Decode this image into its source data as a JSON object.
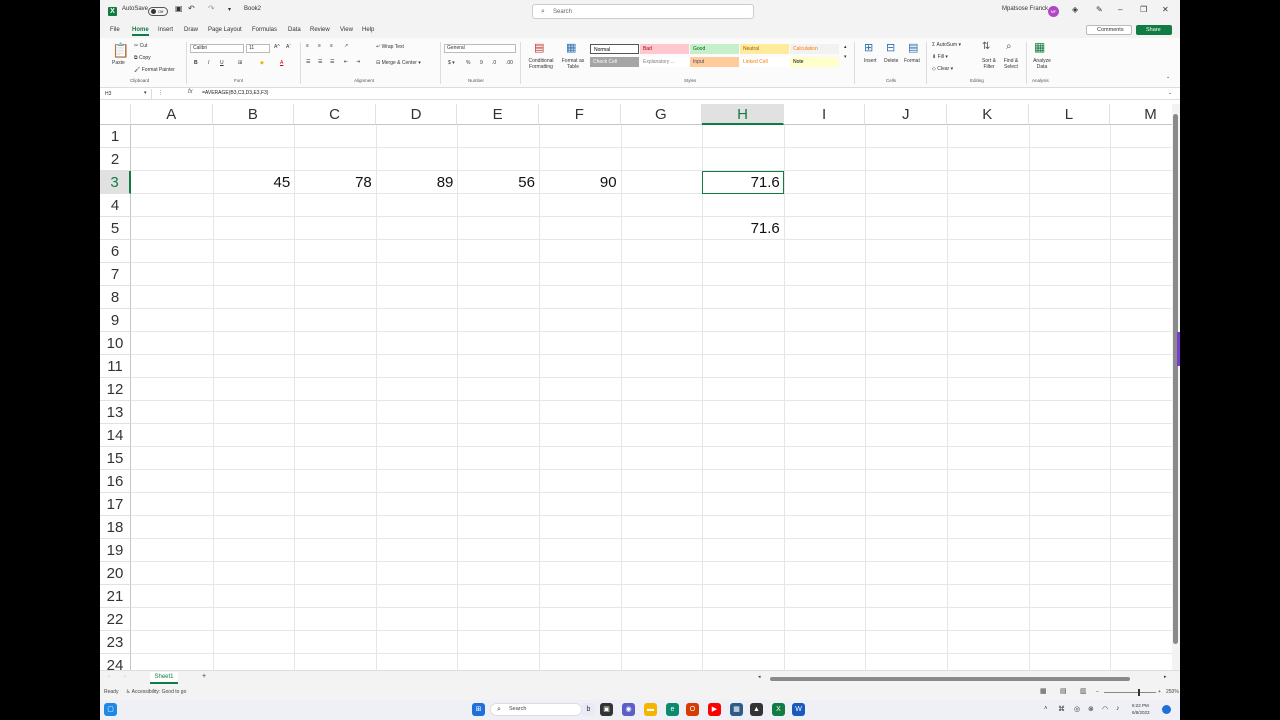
{
  "titlebar": {
    "autosave_label": "AutoSave",
    "autosave_state": "Off",
    "filename": "Book2",
    "search_placeholder": "Search",
    "user_name": "Mpatsose Franck",
    "user_initials": "MF"
  },
  "tabs": [
    "File",
    "Home",
    "Insert",
    "Draw",
    "Page Layout",
    "Formulas",
    "Data",
    "Review",
    "View",
    "Help"
  ],
  "active_tab": "Home",
  "actions": {
    "comments": "Comments",
    "share": "Share"
  },
  "ribbon": {
    "clipboard": {
      "paste": "Paste",
      "cut": "Cut",
      "copy": "Copy",
      "format_painter": "Format Painter",
      "label": "Clipboard"
    },
    "font": {
      "name": "Calibri",
      "size": "11",
      "label": "Font"
    },
    "alignment": {
      "wrap": "Wrap Text",
      "merge": "Merge & Center",
      "label": "Alignment"
    },
    "number": {
      "format": "General",
      "label": "Number"
    },
    "styles": {
      "conditional": "Conditional Formatting",
      "format_table": "Format as Table",
      "cells": [
        {
          "name": "Normal",
          "bg": "#ffffff",
          "fg": "#000000"
        },
        {
          "name": "Bad",
          "bg": "#ffc7ce",
          "fg": "#9c0006"
        },
        {
          "name": "Good",
          "bg": "#c6efce",
          "fg": "#006100"
        },
        {
          "name": "Neutral",
          "bg": "#ffeb9c",
          "fg": "#9c5700"
        },
        {
          "name": "Calculation",
          "bg": "#f2f2f2",
          "fg": "#fa7d00"
        },
        {
          "name": "Check Cell",
          "bg": "#a5a5a5",
          "fg": "#ffffff"
        },
        {
          "name": "Explanatory ...",
          "bg": "#ffffff",
          "fg": "#7f7f7f"
        },
        {
          "name": "Input",
          "bg": "#ffcc99",
          "fg": "#3f3f76"
        },
        {
          "name": "Linked Cell",
          "bg": "#ffffff",
          "fg": "#fa7d00"
        },
        {
          "name": "Note",
          "bg": "#ffffcc",
          "fg": "#000000"
        }
      ],
      "label": "Styles"
    },
    "cells": {
      "insert": "Insert",
      "delete": "Delete",
      "format": "Format",
      "label": "Cells"
    },
    "editing": {
      "autosum": "AutoSum",
      "fill": "Fill",
      "clear": "Clear",
      "sort": "Sort & Filter",
      "find": "Find & Select",
      "label": "Editing"
    },
    "analysis": {
      "analyze": "Analyze Data",
      "label": "Analysis"
    }
  },
  "formula_bar": {
    "name_box": "H3",
    "formula": "=AVERAGE(B3,C3,D3,E3,F3)"
  },
  "columns": [
    "A",
    "B",
    "C",
    "D",
    "E",
    "F",
    "G",
    "H",
    "I",
    "J",
    "K",
    "L",
    "M"
  ],
  "rows": [
    "1",
    "2",
    "3",
    "4",
    "5",
    "6",
    "7",
    "8",
    "9",
    "10",
    "11",
    "12",
    "13",
    "14",
    "15",
    "16",
    "17",
    "18",
    "19",
    "20",
    "21",
    "22",
    "23",
    "24"
  ],
  "selected_cell": {
    "col": "H",
    "row": "3"
  },
  "cells": [
    {
      "ref": "B3",
      "value": "45"
    },
    {
      "ref": "C3",
      "value": "78"
    },
    {
      "ref": "D3",
      "value": "89"
    },
    {
      "ref": "E3",
      "value": "56"
    },
    {
      "ref": "F3",
      "value": "90"
    },
    {
      "ref": "H3",
      "value": "71.6"
    },
    {
      "ref": "H5",
      "value": "71.6"
    }
  ],
  "sheets": [
    "Sheet1"
  ],
  "status": {
    "ready": "Ready",
    "accessibility": "Accessibility: Good to go",
    "zoom": "250%"
  },
  "taskbar": {
    "search": "Search",
    "time": "6:22 PM",
    "date": "6/8/2023"
  },
  "colors": {
    "accent": "#107c41"
  }
}
